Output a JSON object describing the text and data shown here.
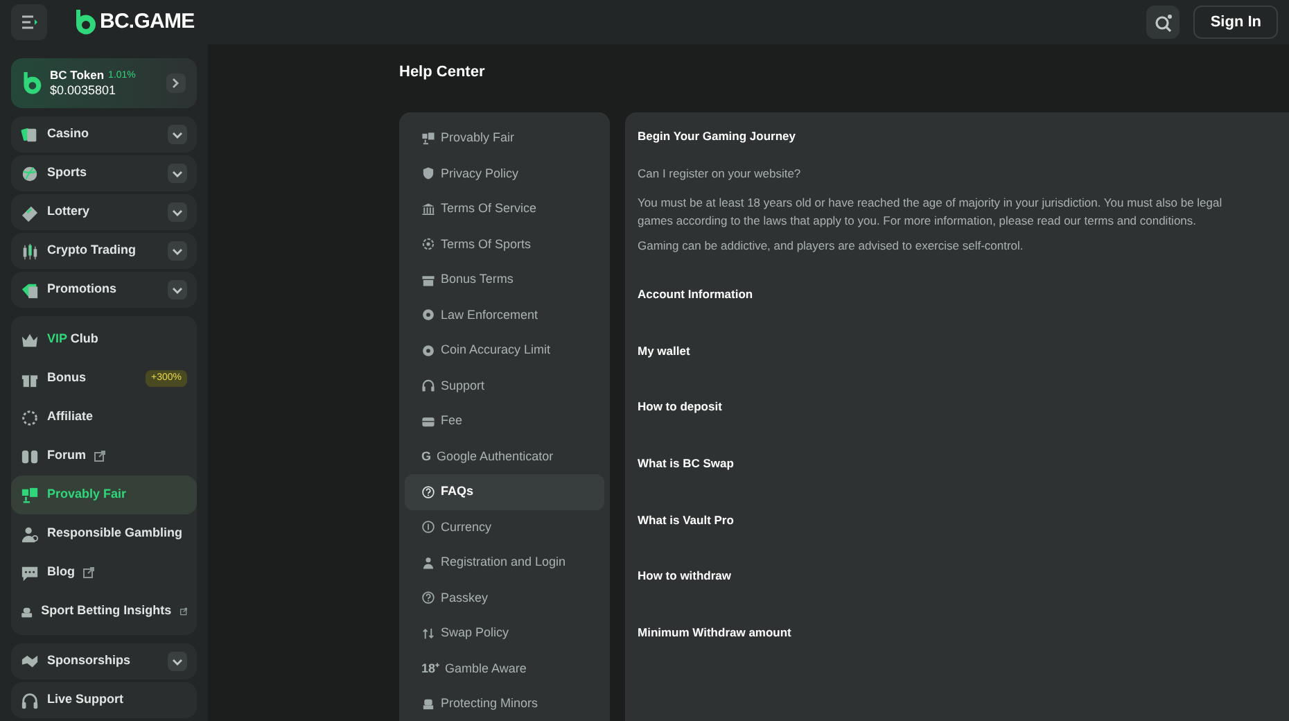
{
  "header": {
    "brand": "BC.GAME",
    "sign_in": "Sign In"
  },
  "token": {
    "name": "BC Token",
    "change": "1.01%",
    "price": "$0.0035801"
  },
  "sidebar": {
    "menus": [
      {
        "label": "Casino",
        "expanded": false
      },
      {
        "label": "Sports",
        "expanded": false
      },
      {
        "label": "Lottery",
        "expanded": false
      },
      {
        "label": "Crypto Trading",
        "expanded": false
      },
      {
        "label": "Promotions",
        "expanded": false
      }
    ],
    "items": [
      {
        "highlight": "VIP",
        "label": "Club",
        "selected": false,
        "external": false
      },
      {
        "label": "Bonus",
        "badge": "+300%",
        "selected": false,
        "external": false
      },
      {
        "label": "Affiliate",
        "selected": false,
        "external": false
      },
      {
        "label": "Forum",
        "selected": false,
        "external": true
      },
      {
        "label": "Provably Fair",
        "selected": true,
        "external": false
      },
      {
        "label": "Responsible Gambling",
        "selected": false,
        "external": false
      },
      {
        "label": "Blog",
        "selected": false,
        "external": true
      },
      {
        "label": "Sport Betting Insights",
        "selected": false,
        "external": true
      }
    ],
    "bottom": [
      {
        "label": "Sponsorships",
        "expanded": false
      },
      {
        "label": "Live Support"
      }
    ]
  },
  "page_title": "Help Center",
  "help_nav": [
    {
      "label": "Provably Fair",
      "selected": false
    },
    {
      "label": "Privacy Policy",
      "selected": false
    },
    {
      "label": "Terms Of Service",
      "selected": false
    },
    {
      "label": "Terms Of Sports",
      "selected": false
    },
    {
      "label": "Bonus Terms",
      "selected": false
    },
    {
      "label": "Law Enforcement",
      "selected": false
    },
    {
      "label": "Coin Accuracy Limit",
      "selected": false
    },
    {
      "label": "Support",
      "selected": false
    },
    {
      "label": "Fee",
      "selected": false
    },
    {
      "prefix": "G",
      "label": "Google Authenticator",
      "selected": false
    },
    {
      "label": "FAQs",
      "selected": true
    },
    {
      "label": "Currency",
      "selected": false
    },
    {
      "label": "Registration and Login",
      "selected": false
    },
    {
      "label": "Passkey",
      "selected": false
    },
    {
      "label": "Swap Policy",
      "selected": false
    },
    {
      "prefix": "18⁺",
      "label": "Gamble Aware",
      "selected": false
    },
    {
      "label": "Protecting Minors",
      "selected": false
    }
  ],
  "faq": [
    {
      "title": "Begin Your Gaming Journey",
      "question": "Can I register on your website?",
      "answers": [
        {
          "lines": [
            "You must be at least 18 years old or have reached the age of majority in your jurisdiction. You must also be legal",
            "games according to the laws that apply to you. For more information, please read our terms and conditions."
          ]
        },
        {
          "lines": [
            "Gaming can be addictive, and players are advised to exercise self-control."
          ]
        }
      ]
    },
    {
      "title": "Account Information"
    },
    {
      "title": "My wallet"
    },
    {
      "title": "How to deposit"
    },
    {
      "title": "What is BC Swap"
    },
    {
      "title": "What is Vault Pro"
    },
    {
      "title": "How to withdraw"
    },
    {
      "title": "Minimum Withdraw amount"
    }
  ]
}
